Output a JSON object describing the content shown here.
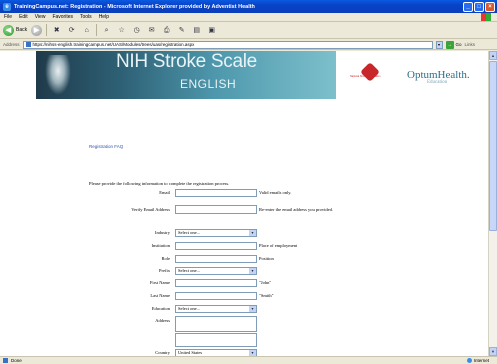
{
  "window": {
    "title": "TrainingCampus.net: Registration - Microsoft Internet Explorer provided by Adventist Health",
    "minimize": "_",
    "maximize": "□",
    "close": "×"
  },
  "menu": {
    "items": [
      "File",
      "Edit",
      "View",
      "Favorites",
      "Tools",
      "Help"
    ]
  },
  "toolbar": {
    "back_label": "Back",
    "back_glyph": "◀",
    "forward_glyph": "▶",
    "stop_glyph": "✖",
    "refresh_glyph": "⟳",
    "home_glyph": "⌂",
    "search_glyph": "⌕",
    "favorites_glyph": "☆",
    "history_glyph": "◷",
    "mail_glyph": "✉",
    "print_glyph": "⎙",
    "edit_glyph": "✎",
    "discuss_glyph": "▤",
    "media_glyph": "▣"
  },
  "address": {
    "label": "Address",
    "url": "https://nihss-english.trainingcampus.net/UAS/Modules/trees/uas/registration.aspx",
    "dropdown_glyph": "▾",
    "go_label": "Go",
    "go_glyph": "→",
    "links_label": "Links"
  },
  "banner": {
    "title": "NIH Stroke Scale",
    "subtitle": "ENGLISH",
    "asa_text": "National Stroke Association",
    "optum": "OptumHealth.",
    "optum_sub": "Education"
  },
  "content": {
    "reg_faq": "Registration FAQ",
    "intro": "Please provide the following information to complete the registration process.",
    "email_label": "Email",
    "email_hint": "Valid emails only.",
    "verify_email_label": "Verify Email Address",
    "verify_email_hint": "Re-enter the email address you provided.",
    "industry_label": "Industry",
    "industry_value": "Select one...",
    "institution_label": "Institution",
    "institution_hint": "Place of employment",
    "role_label": "Role",
    "role_hint": "Position",
    "prefix_label": "Prefix",
    "prefix_value": "Select one...",
    "first_name_label": "First Name",
    "first_name_hint": "\"John\"",
    "last_name_label": "Last Name",
    "last_name_hint": "\"Smith\"",
    "education_label": "Education",
    "education_value": "Select one...",
    "address_label": "Address",
    "country_label": "Country",
    "country_value": "United States",
    "select_arrow": "▼"
  },
  "status": {
    "text": "Done",
    "zone": "Internet"
  }
}
